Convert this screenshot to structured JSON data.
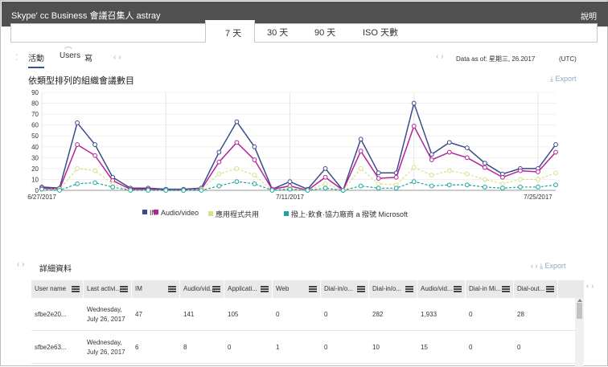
{
  "window": {
    "title": "Skype' cc Business 會議召集人 astray",
    "help": "說明"
  },
  "range_tabs": [
    {
      "label": "7 天",
      "active": true
    },
    {
      "label": "30 天",
      "active": false
    },
    {
      "label": "90 天",
      "active": false
    },
    {
      "label": "ISO 天數",
      "active": false
    }
  ],
  "view_tabs": [
    {
      "label": "活動",
      "active": true
    },
    {
      "label": "Users",
      "active": false
    },
    {
      "label": "寫",
      "active": false
    }
  ],
  "data_as_of": "Data as of: 星期三, 26.2017",
  "timezone": "(UTC)",
  "chart_section": {
    "title": "依類型排列的組織會議數目",
    "export_label": "Export"
  },
  "chart_data": {
    "type": "line",
    "title": "依類型排列的組織會議數目",
    "ylim": [
      0,
      90
    ],
    "yticks": [
      0,
      10,
      20,
      30,
      40,
      50,
      60,
      70,
      80,
      90
    ],
    "x_tick_labels": [
      "6/27/2017",
      "7/11/2017",
      "7/25/2017"
    ],
    "x": [
      "6/27",
      "6/28",
      "6/29",
      "6/30",
      "7/1",
      "7/2",
      "7/3",
      "7/4",
      "7/5",
      "7/6",
      "7/7",
      "7/8",
      "7/9",
      "7/10",
      "7/11",
      "7/12",
      "7/13",
      "7/14",
      "7/15",
      "7/16",
      "7/17",
      "7/18",
      "7/19",
      "7/20",
      "7/21",
      "7/22",
      "7/23",
      "7/24",
      "7/25",
      "7/26"
    ],
    "grid": true,
    "legend_position": "bottom",
    "series": [
      {
        "name": "IM",
        "color": "#3b4a8a",
        "values": [
          3,
          2,
          62,
          42,
          12,
          2,
          2,
          1,
          1,
          2,
          35,
          63,
          40,
          1,
          8,
          1,
          20,
          0,
          47,
          16,
          16,
          80,
          33,
          44,
          39,
          25,
          15,
          20,
          20,
          42
        ]
      },
      {
        "name": "Audio/video",
        "color": "#b4239a",
        "values": [
          2,
          1,
          42,
          32,
          9,
          1,
          1,
          0,
          0,
          1,
          26,
          44,
          28,
          1,
          4,
          0,
          12,
          0,
          36,
          11,
          12,
          59,
          28,
          35,
          30,
          21,
          12,
          18,
          17,
          35
        ]
      },
      {
        "name": "應用程式共用",
        "color": "#d9e08a",
        "values": [
          1,
          1,
          20,
          18,
          6,
          0,
          0,
          0,
          0,
          1,
          15,
          20,
          14,
          0,
          2,
          0,
          6,
          0,
          20,
          6,
          5,
          21,
          14,
          18,
          15,
          10,
          6,
          10,
          10,
          16
        ]
      },
      {
        "name": "撥上·飲食·協力廠商 a 撥號 Microsoft",
        "color": "#1aa5a0",
        "values": [
          1,
          0,
          6,
          7,
          3,
          0,
          0,
          0,
          0,
          0,
          4,
          8,
          6,
          0,
          1,
          0,
          2,
          0,
          4,
          2,
          2,
          8,
          4,
          5,
          5,
          3,
          2,
          3,
          3,
          5
        ]
      }
    ]
  },
  "details": {
    "title": "詳細資料",
    "export_label": "Export",
    "columns": [
      "User name",
      "Last activi...",
      "IM",
      "Audio/vid...",
      "Applicati...",
      "Web",
      "Dial-in/o...",
      "Dial-in/o...",
      "Audio/vid...",
      "Dial-in Mi...",
      "Dial-out..."
    ],
    "rows": [
      [
        "sfbe2e20...",
        "Wednesday, July 26, 2017",
        "47",
        "141",
        "105",
        "0",
        "0",
        "282",
        "1,933",
        "0",
        "28"
      ],
      [
        "sfbe2e63...",
        "Wednesday, July 26, 2017",
        "6",
        "8",
        "0",
        "1",
        "0",
        "10",
        "15",
        "0",
        "0"
      ]
    ]
  }
}
